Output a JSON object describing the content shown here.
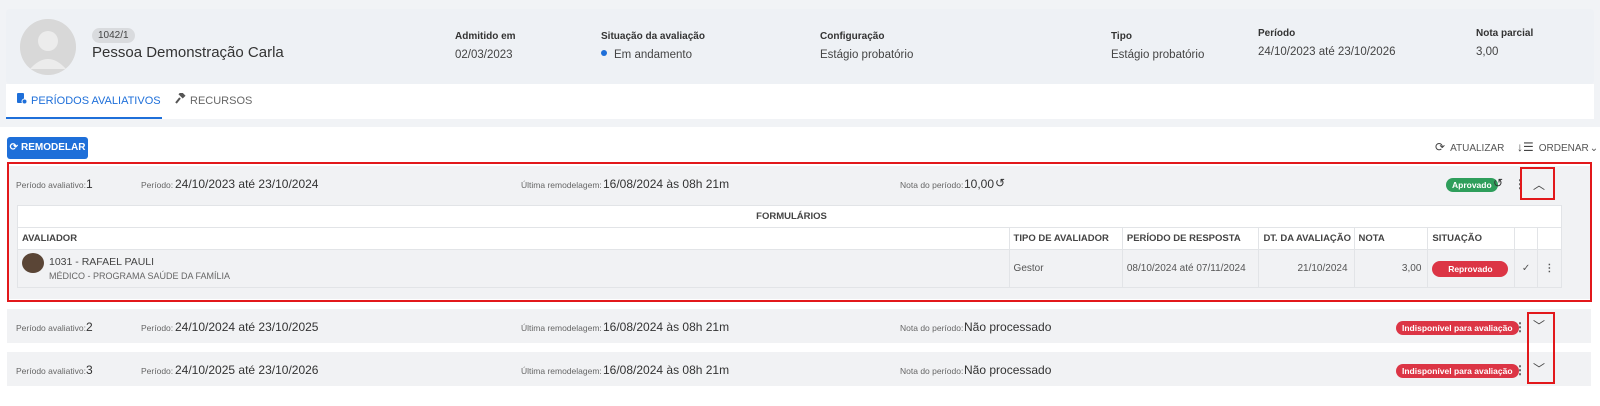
{
  "header": {
    "person_id": "1042/1",
    "person_name": "Pessoa Demonstração Carla",
    "admitted_label": "Admitido em",
    "admitted_value": "02/03/2023",
    "situation_label": "Situação da avaliação",
    "situation_value": "Em andamento",
    "config_label": "Configuração",
    "config_value": "Estágio probatório",
    "type_label": "Tipo",
    "type_value": "Estágio probatório",
    "period_label": "Período",
    "period_value": "24/10/2023 até 23/10/2026",
    "partial_label": "Nota parcial",
    "partial_value": "3,00"
  },
  "tabs": [
    {
      "label": "PERÍODOS AVALIATIVOS",
      "icon": "document-gear-icon",
      "active": true
    },
    {
      "label": "RECURSOS",
      "icon": "gavel-icon",
      "active": false
    }
  ],
  "toolbar": {
    "remodel_label": "REMODELAR",
    "refresh_label": "ATUALIZAR",
    "sort_label": "ORDENAR"
  },
  "period_labels": {
    "period_eval": "Período avaliativo:",
    "period": "Período:",
    "last_remodel": "Última remodelagem:",
    "grade": "Nota do período:"
  },
  "periods": [
    {
      "number": "1",
      "range": "24/10/2023 até 23/10/2024",
      "last_remodel": "16/08/2024 às 08h 21m",
      "grade": "10,00",
      "status": "Aprovado",
      "status_color": "#2e9e5b",
      "expanded": true
    },
    {
      "number": "2",
      "range": "24/10/2024 até 23/10/2025",
      "last_remodel": "16/08/2024 às 08h 21m",
      "grade": "Não processado",
      "status": "Indisponível para avaliação",
      "status_color": "#dc3545",
      "expanded": false
    },
    {
      "number": "3",
      "range": "24/10/2025 até 23/10/2026",
      "last_remodel": "16/08/2024 às 08h 21m",
      "grade": "Não processado",
      "status": "Indisponível para avaliação",
      "status_color": "#dc3545",
      "expanded": false
    }
  ],
  "forms": {
    "title": "FORMULÁRIOS",
    "columns": [
      "AVALIADOR",
      "TIPO DE AVALIADOR",
      "PERÍODO DE RESPOSTA",
      "DT. DA AVALIAÇÃO",
      "NOTA",
      "SITUAÇÃO"
    ],
    "rows": [
      {
        "evaluator": "1031 - RAFAEL PAULI",
        "role": "MÉDICO - PROGRAMA SAÚDE DA FAMÍLIA",
        "type": "Gestor",
        "response_period": "08/10/2024 até 07/11/2024",
        "date": "21/10/2024",
        "grade": "3,00",
        "status": "Reprovado"
      }
    ]
  },
  "colors": {
    "accent": "#1e6fd9",
    "success": "#2e9e5b",
    "danger": "#dc3545",
    "highlight": "#e2181b"
  }
}
